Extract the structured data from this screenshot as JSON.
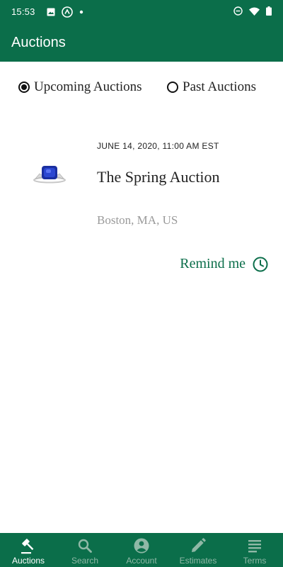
{
  "status_bar": {
    "time": "15:53",
    "left_icons": [
      "image-icon",
      "app-icon",
      "dot-icon"
    ],
    "right_icons": [
      "do-not-disturb-icon",
      "wifi-icon",
      "battery-icon"
    ]
  },
  "app_bar": {
    "title": "Auctions"
  },
  "filters": {
    "upcoming_label": "Upcoming Auctions",
    "past_label": "Past Auctions",
    "selected": "upcoming"
  },
  "auction": {
    "date": "JUNE 14, 2020, 11:00 AM EST",
    "title": "The Spring Auction",
    "location": "Boston, MA, US",
    "remind_label": "Remind me"
  },
  "bottom_nav": {
    "items": [
      {
        "label": "Auctions",
        "icon": "gavel-icon",
        "active": true
      },
      {
        "label": "Search",
        "icon": "search-icon",
        "active": false
      },
      {
        "label": "Account",
        "icon": "account-icon",
        "active": false
      },
      {
        "label": "Estimates",
        "icon": "pencil-icon",
        "active": false
      },
      {
        "label": "Terms",
        "icon": "document-icon",
        "active": false
      }
    ]
  },
  "colors": {
    "brand": "#0b6e4a",
    "nav_inactive": "#8fb8a6",
    "location_text": "#9a9a9a"
  }
}
